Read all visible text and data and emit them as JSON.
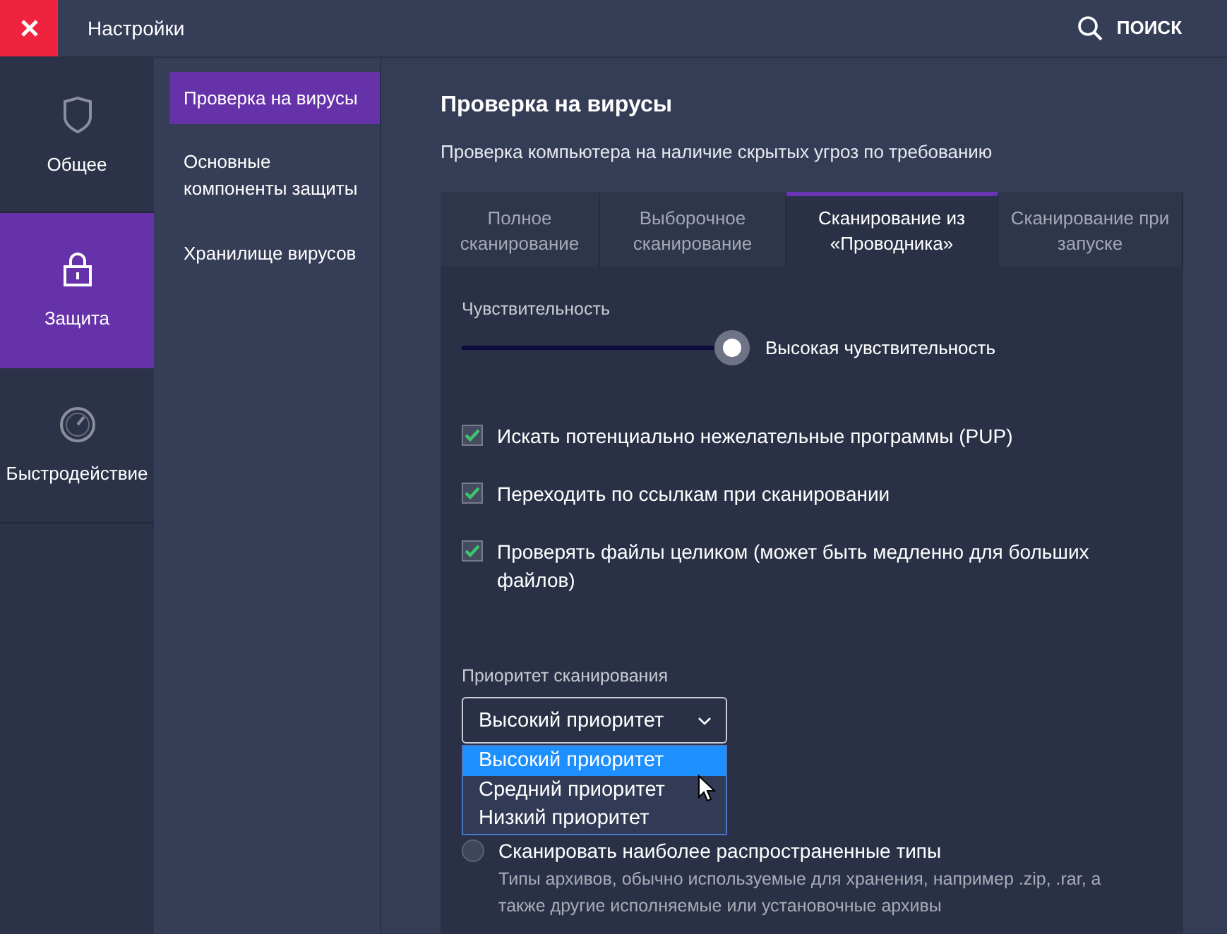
{
  "window": {
    "title": "Настройки"
  },
  "search": {
    "label": "ПОИСК"
  },
  "nav": [
    {
      "label": "Общее",
      "selected": false
    },
    {
      "label": "Защита",
      "selected": true
    },
    {
      "label": "Быстродействие",
      "selected": false
    }
  ],
  "subnav": [
    {
      "label": "Проверка на вирусы",
      "selected": true
    },
    {
      "label": "Основные компоненты защиты",
      "selected": false
    },
    {
      "label": "Хранилище вирусов",
      "selected": false
    }
  ],
  "page": {
    "title": "Проверка на вирусы",
    "subtitle": "Проверка компьютера на наличие скрытых угроз по требованию"
  },
  "tabs": [
    {
      "label": "Полное сканирование",
      "selected": false
    },
    {
      "label": "Выборочное сканирование",
      "selected": false
    },
    {
      "label": "Сканирование из «Проводника»",
      "selected": true
    },
    {
      "label": "Сканирование при запуске",
      "selected": false
    }
  ],
  "sensitivity": {
    "label": "Чувствительность",
    "level": 1,
    "reading": "Высокая чувствительность"
  },
  "options": [
    {
      "label": "Искать потенциально нежелательные программы (PUP)",
      "checked": true
    },
    {
      "label": "Переходить по ссылкам при сканировании",
      "checked": true
    },
    {
      "label": "Проверять файлы целиком (может быть медленно для больших файлов)",
      "checked": true
    }
  ],
  "priority": {
    "label": "Приоритет сканирования",
    "value": "Высокий приоритет",
    "expanded": true,
    "choices": [
      {
        "label": "Высокий приоритет",
        "selected": true
      },
      {
        "label": "Средний приоритет",
        "selected": false
      },
      {
        "label": "Низкий приоритет",
        "selected": false
      }
    ]
  },
  "archive_mode": {
    "label": "Сканировать наиболее распространенные типы",
    "selected": false,
    "description": "Типы архивов, обычно используемые для хранения, например .zip, .rar, а также другие исполняемые или установочные архивы"
  }
}
